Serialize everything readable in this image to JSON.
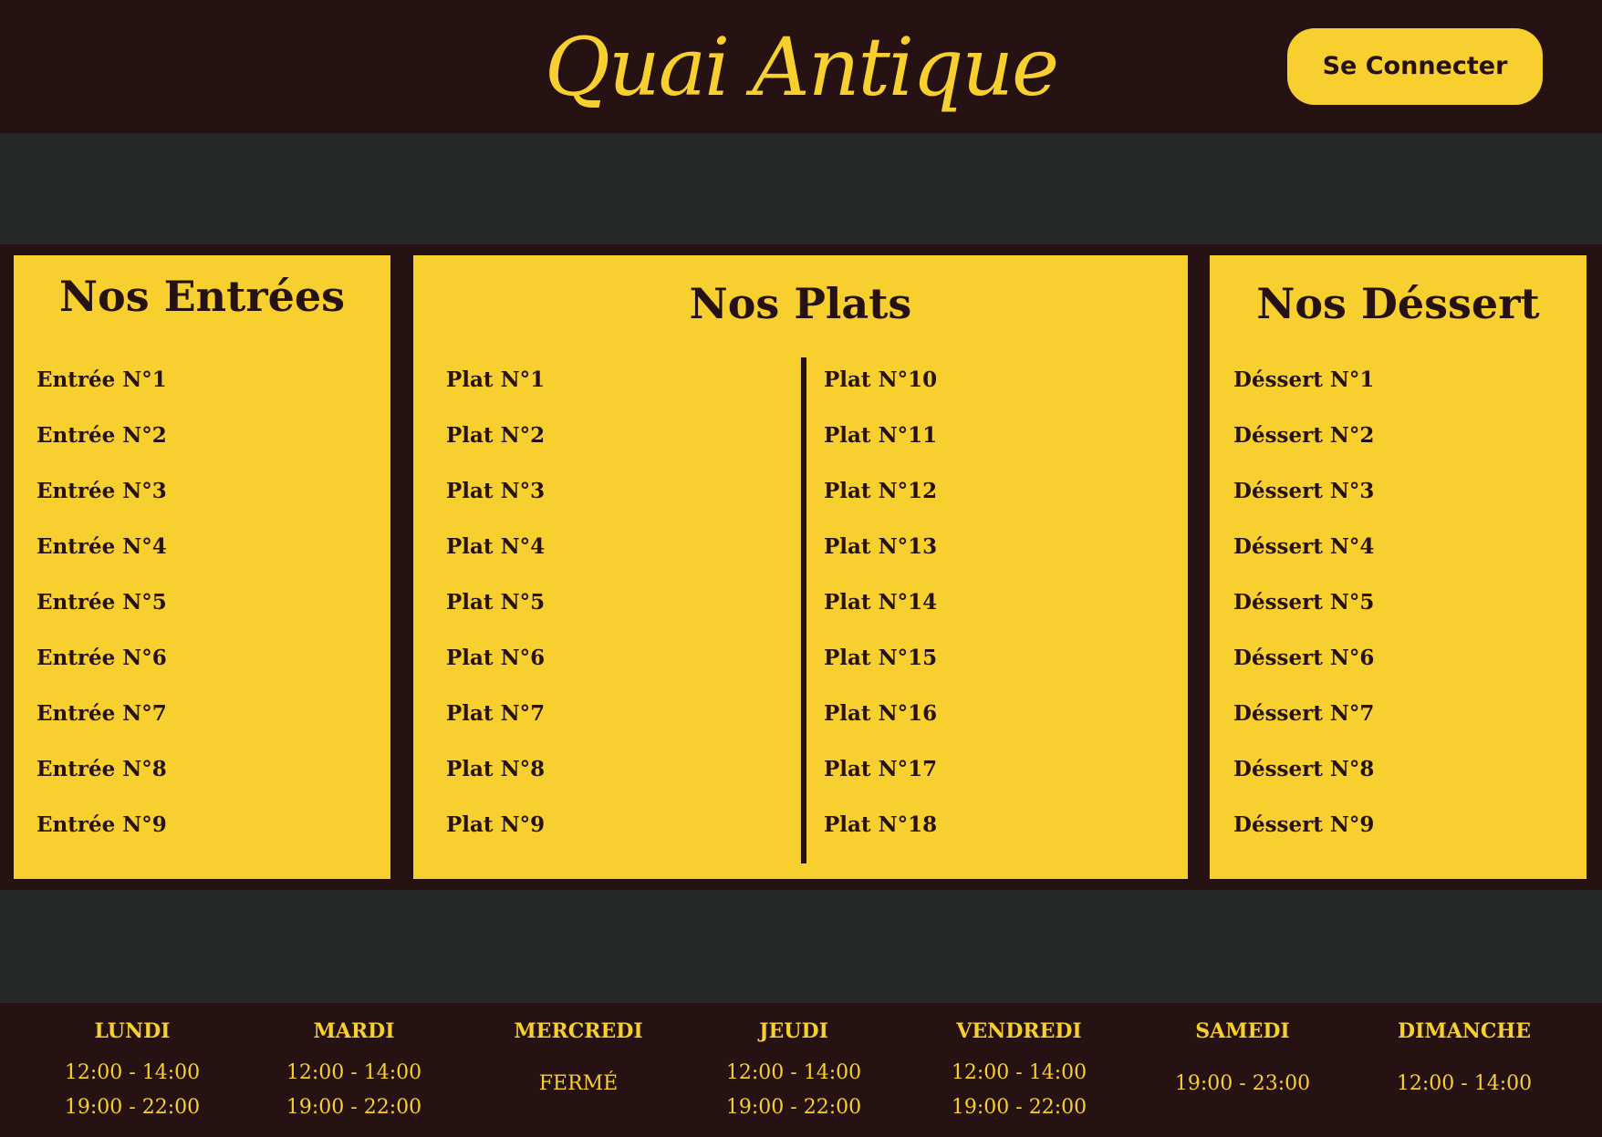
{
  "header": {
    "logo": "Quai Antique",
    "login_label": "Se Connecter"
  },
  "menu": {
    "entrees": {
      "title": "Nos Entrées",
      "items": [
        "Entrée N°1",
        "Entrée N°2",
        "Entrée N°3",
        "Entrée N°4",
        "Entrée N°5",
        "Entrée N°6",
        "Entrée N°7",
        "Entrée N°8",
        "Entrée N°9"
      ]
    },
    "plats": {
      "title": "Nos Plats",
      "items_left": [
        "Plat N°1",
        "Plat N°2",
        "Plat N°3",
        "Plat N°4",
        "Plat N°5",
        "Plat N°6",
        "Plat N°7",
        "Plat N°8",
        "Plat N°9"
      ],
      "items_right": [
        "Plat N°10",
        "Plat N°11",
        "Plat N°12",
        "Plat N°13",
        "Plat N°14",
        "Plat N°15",
        "Plat N°16",
        "Plat N°17",
        "Plat N°18"
      ]
    },
    "desserts": {
      "title": "Nos Déssert",
      "items": [
        "Déssert N°1",
        "Déssert N°2",
        "Déssert N°3",
        "Déssert N°4",
        "Déssert N°5",
        "Déssert N°6",
        "Déssert N°7",
        "Déssert N°8",
        "Déssert N°9"
      ]
    }
  },
  "hours": [
    {
      "day": "LUNDI",
      "lines": [
        "12:00 - 14:00",
        "19:00 - 22:00"
      ]
    },
    {
      "day": "MARDI",
      "lines": [
        "12:00 - 14:00",
        "19:00 - 22:00"
      ]
    },
    {
      "day": "MERCREDI",
      "lines": [
        "FERMÉ"
      ]
    },
    {
      "day": "JEUDI",
      "lines": [
        "12:00 - 14:00",
        "19:00 - 22:00"
      ]
    },
    {
      "day": "VENDREDI",
      "lines": [
        "12:00 - 14:00",
        "19:00 - 22:00"
      ]
    },
    {
      "day": "SAMEDI",
      "lines": [
        "19:00 - 23:00"
      ]
    },
    {
      "day": "DIMANCHE",
      "lines": [
        "12:00 - 14:00"
      ]
    }
  ],
  "colors": {
    "accent": "#f7cf2f",
    "dark": "#261213",
    "gap": "#262828"
  }
}
